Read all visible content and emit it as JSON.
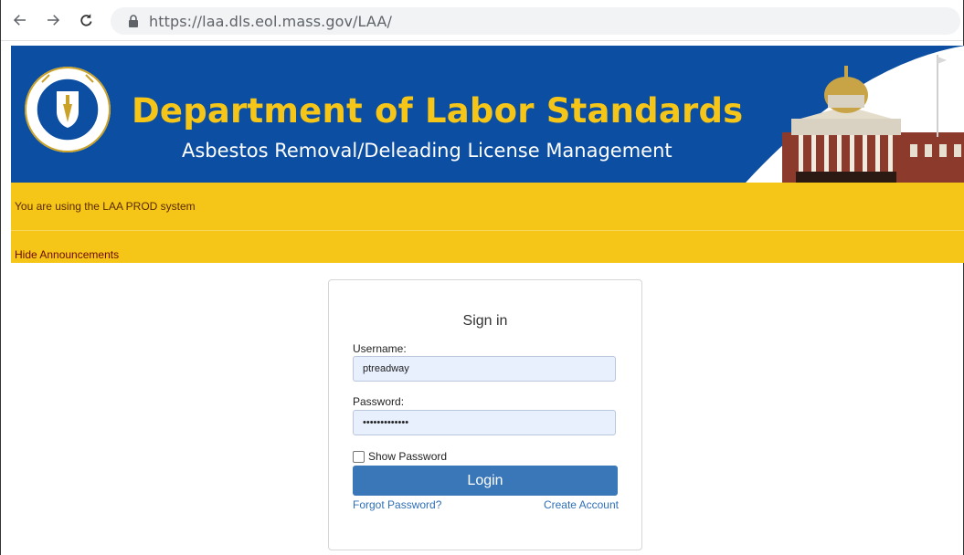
{
  "browser": {
    "url": "https://laa.dls.eol.mass.gov/LAA/"
  },
  "banner": {
    "title": "Department of Labor Standards",
    "subtitle": "Asbestos Removal/Deleading License Management"
  },
  "announcements": {
    "system_text": "You are using the LAA PROD system",
    "hide_link": "Hide Announcements"
  },
  "login": {
    "heading": "Sign in",
    "username_label": "Username:",
    "username_value": "ptreadway",
    "password_label": "Password:",
    "password_value": "•••••••••••••",
    "show_password_label": "Show Password",
    "login_button": "Login",
    "forgot_password": "Forgot Password?",
    "create_account": "Create Account"
  },
  "colors": {
    "banner_blue": "#0b4ea2",
    "gold": "#f5c518",
    "button_blue": "#3a77b8",
    "input_bg": "#e8f0fe"
  }
}
